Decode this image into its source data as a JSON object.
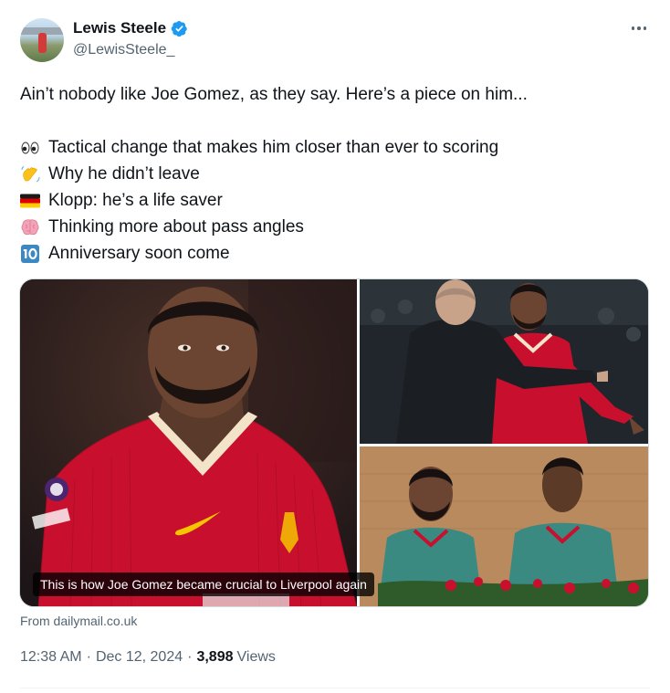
{
  "author": {
    "name": "Lewis Steele",
    "handle": "@LewisSteele_",
    "verified": true
  },
  "tweet": {
    "intro": "Ain’t nobody like Joe Gomez, as they say. Here’s a piece on him...",
    "bullets": [
      {
        "icon": "eyes-emoji",
        "text": "Tactical change that makes him closer than ever to scoring"
      },
      {
        "icon": "waving-hand-emoji",
        "text": "Why he didn’t leave"
      },
      {
        "icon": "germany-flag-emoji",
        "text": "Klopp: he’s a life saver"
      },
      {
        "icon": "brain-emoji",
        "text": "Thinking more about pass angles"
      },
      {
        "icon": "keycap-ten-emoji",
        "text": "Anniversary soon come"
      }
    ]
  },
  "card": {
    "caption": "This is how Joe Gomez became crucial to Liverpool again",
    "source": "From dailymail.co.uk"
  },
  "meta": {
    "time": "12:38 AM",
    "date": "Dec 12, 2024",
    "views_count": "3,898",
    "views_label": "Views",
    "separator": "·"
  },
  "colors": {
    "text": "#0f1419",
    "secondary": "#536471",
    "verified": "#1d9bf0",
    "liverpool_red": "#c8102e"
  }
}
